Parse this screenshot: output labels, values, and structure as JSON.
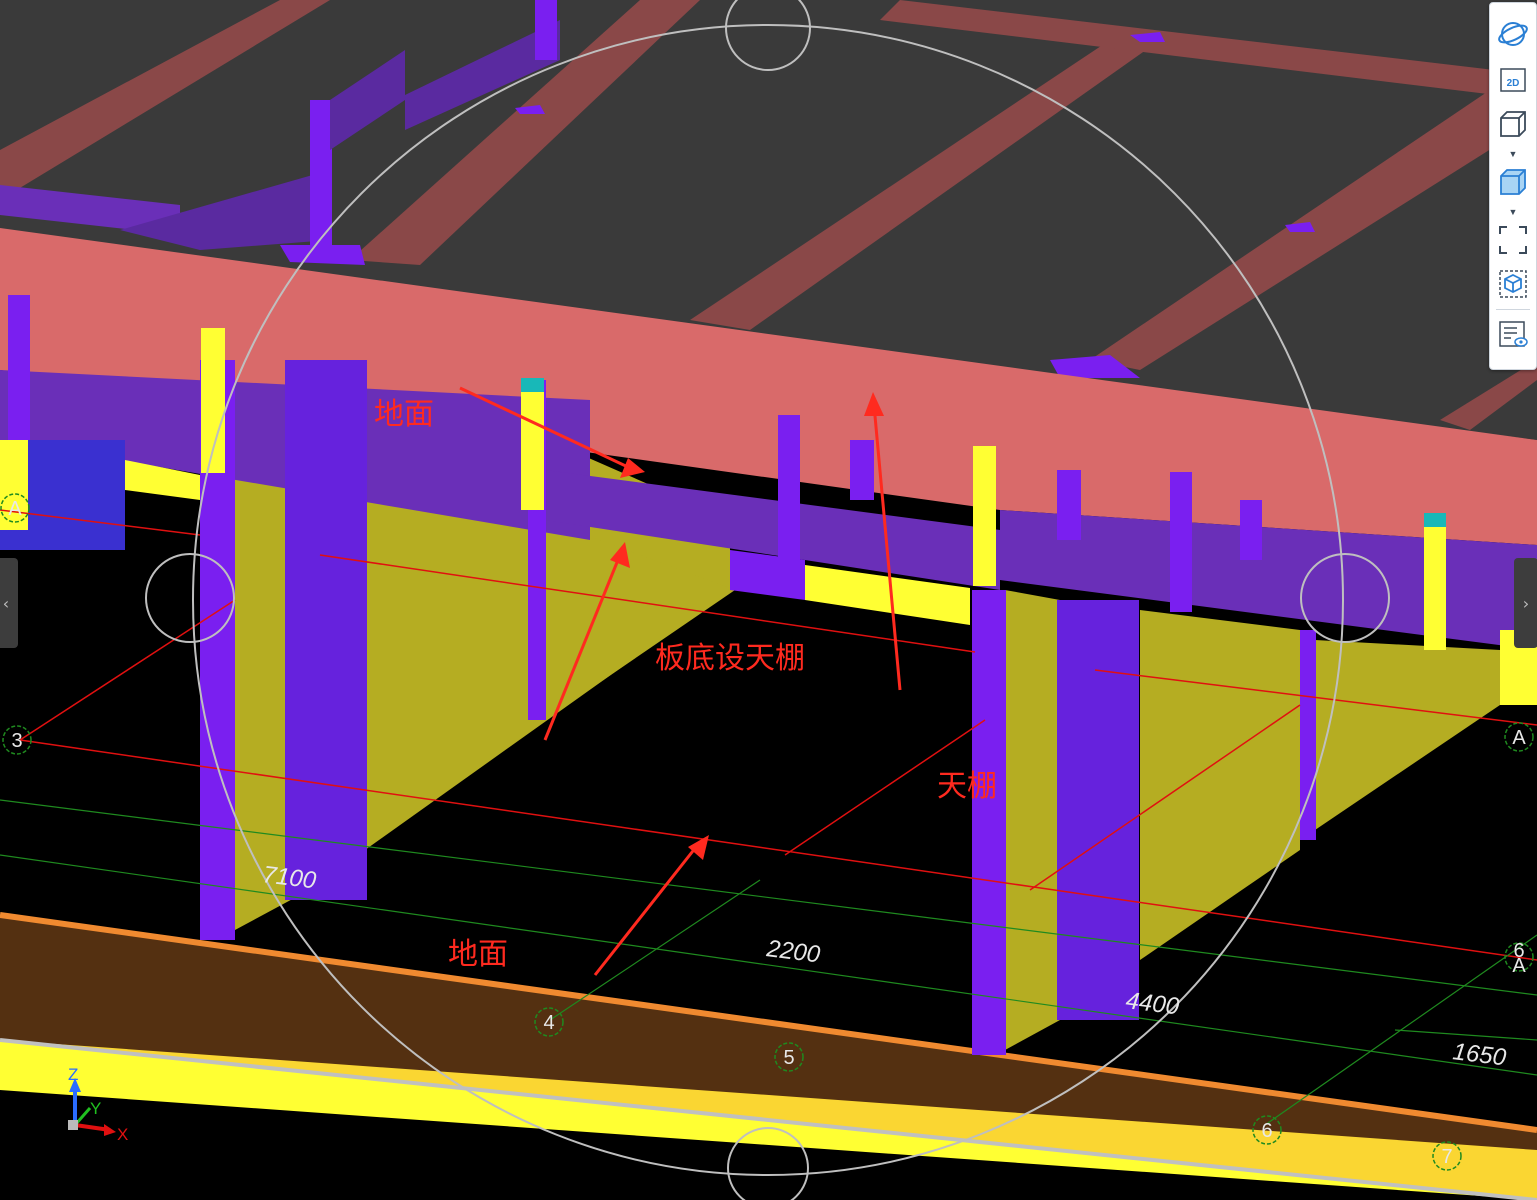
{
  "annotations": [
    {
      "id": "ann1",
      "text": "地面"
    },
    {
      "id": "ann2",
      "text": "板底设天棚"
    },
    {
      "id": "ann3",
      "text": "天棚"
    },
    {
      "id": "ann4",
      "text": "地面"
    }
  ],
  "dimensions": [
    "7100",
    "2200",
    "4400",
    "1650"
  ],
  "grid_markers": [
    "A",
    "3",
    "A",
    "6",
    "A",
    "4",
    "5",
    "6",
    "7"
  ],
  "axes": {
    "z": "Z",
    "y": "Y",
    "x": "X"
  },
  "toolbar": {
    "items": [
      "orbit-icon",
      "2d-view-icon",
      "box-view-icon",
      "shaded-box-view-icon",
      "fit-view-icon",
      "component-view-icon",
      "properties-view-icon"
    ],
    "label_2d": "2D",
    "caret": "▼"
  },
  "side_tabs": {
    "left": "‹",
    "right": "›"
  },
  "colors": {
    "annotation": "#ff2a1f",
    "beam_salmon": "#d96a6a",
    "column_purple": "#7a1ff0",
    "wall_yellow": "#b5ad22",
    "bright_yellow": "#ffff33",
    "railing_orange": "#f08a30",
    "slab_gray": "#3a3a3a",
    "grid_green": "#1f8a1f",
    "axis_red": "#e01010"
  }
}
